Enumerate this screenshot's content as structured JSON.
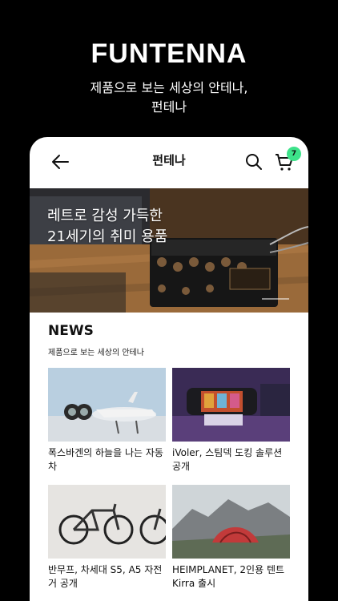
{
  "brand": "FUNTENNA",
  "tagline": [
    "제품으로 보는 세상의 안테나,",
    "펀테나"
  ],
  "app": {
    "title": "펀테나",
    "cart_count": "7",
    "icons": {
      "back": "back-arrow-icon",
      "search": "search-icon",
      "cart": "cart-icon"
    }
  },
  "hero": {
    "lines": [
      "레트로 감성 가득한",
      "21세기의 취미 용품"
    ]
  },
  "news": {
    "title": "NEWS",
    "subtitle": "제품으로 보는 세상의 안테나",
    "items": [
      {
        "title": "폭스바겐의 하늘을 나는 자동차",
        "image": "flying-car-image"
      },
      {
        "title": "iVoler, 스팀덱 도킹 솔루션 공개",
        "image": "steam-deck-dock-image"
      },
      {
        "title": "반무프, 차세대 S5, A5 자전거 공개",
        "image": "bicycles-image"
      },
      {
        "title": "HEIMPLANET, 2인용 텐트 Kirra 출시",
        "image": "tent-mountain-image"
      }
    ]
  },
  "colors": {
    "background": "#000000",
    "badge": "#3de38a",
    "card": "#ffffff"
  }
}
